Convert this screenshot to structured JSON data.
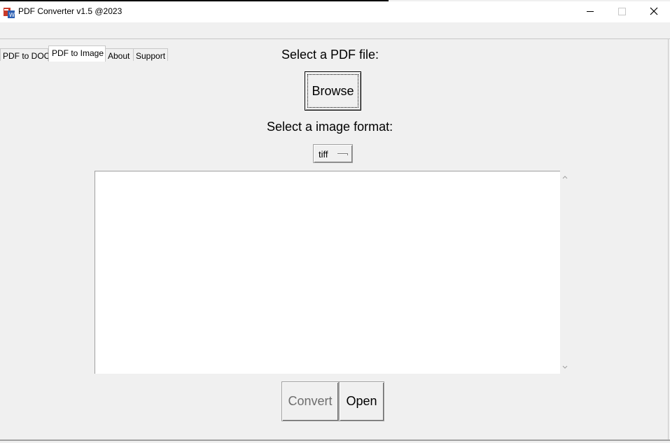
{
  "window": {
    "title": "PDF Converter v1.5 @2023",
    "controls": [
      "minimize-icon",
      "maximize-icon",
      "close-icon"
    ]
  },
  "tabs": [
    {
      "label": "PDF to DOC",
      "active": false
    },
    {
      "label": "PDF to Image",
      "active": true
    },
    {
      "label": "About",
      "active": false
    },
    {
      "label": "Support",
      "active": false
    }
  ],
  "main": {
    "select_pdf_label": "Select a PDF file:",
    "browse_label": "Browse",
    "select_format_label": "Select a image format:",
    "format_value": "tiff",
    "log_text": "",
    "convert_label": "Convert",
    "open_label": "Open"
  },
  "colors": {
    "background": "#f0f0f0",
    "disabled_text": "#6d6d6d"
  }
}
